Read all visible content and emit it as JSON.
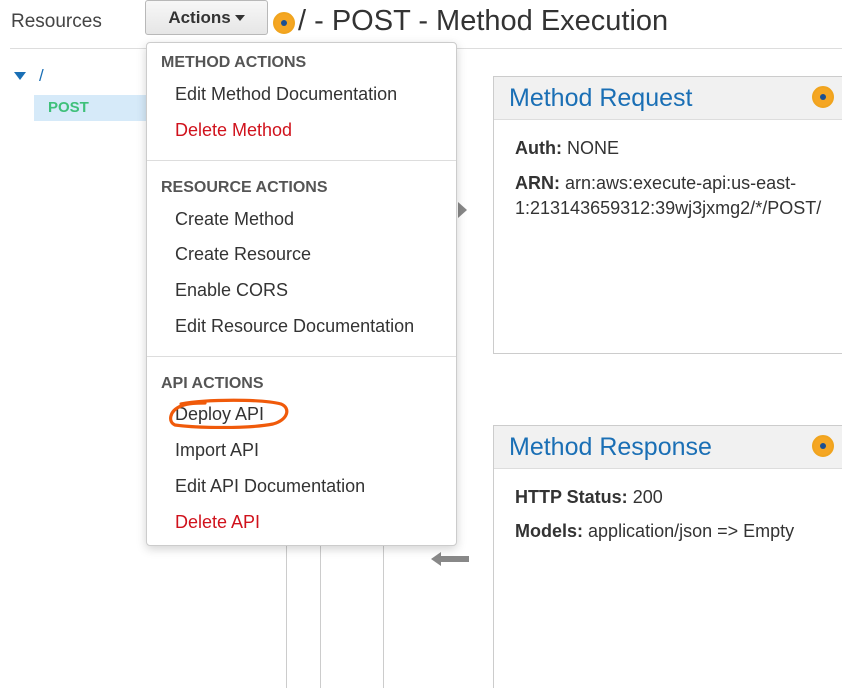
{
  "sidebar": {
    "title": "Resources",
    "tree": {
      "root_label": "/",
      "child_label": "POST"
    }
  },
  "toolbar": {
    "actions_label": "Actions"
  },
  "page": {
    "title": "/ - POST - Method Execution"
  },
  "actions_menu": {
    "sections": [
      {
        "title": "METHOD ACTIONS",
        "items": [
          "Edit Method Documentation",
          "Delete Method"
        ]
      },
      {
        "title": "RESOURCE ACTIONS",
        "items": [
          "Create Method",
          "Create Resource",
          "Enable CORS",
          "Edit Resource Documentation"
        ]
      },
      {
        "title": "API ACTIONS",
        "items": [
          "Deploy API",
          "Import API",
          "Edit API Documentation",
          "Delete API"
        ]
      }
    ]
  },
  "method_request": {
    "title": "Method Request",
    "auth_label": "Auth:",
    "auth_value": "NONE",
    "arn_label": "ARN:",
    "arn_value_line1": "arn:aws:execute-api:us-east-",
    "arn_value_line2": "1:213143659312:39wj3jxmg2/*/POST/"
  },
  "method_response": {
    "title": "Method Response",
    "status_label": "HTTP Status:",
    "status_value": "200",
    "models_label": "Models:",
    "models_value": "application/json => Empty"
  },
  "colors": {
    "accent_blue": "#1a6fb5",
    "danger_red": "#d0121c",
    "post_green": "#3fc07a",
    "highlight_orange": "#f05a0a",
    "status_orange": "#f5a623"
  },
  "icons": [
    "expand-caret-icon",
    "status-dot-icon",
    "arrow-right-icon",
    "arrow-left-icon",
    "dropdown-caret-icon"
  ]
}
